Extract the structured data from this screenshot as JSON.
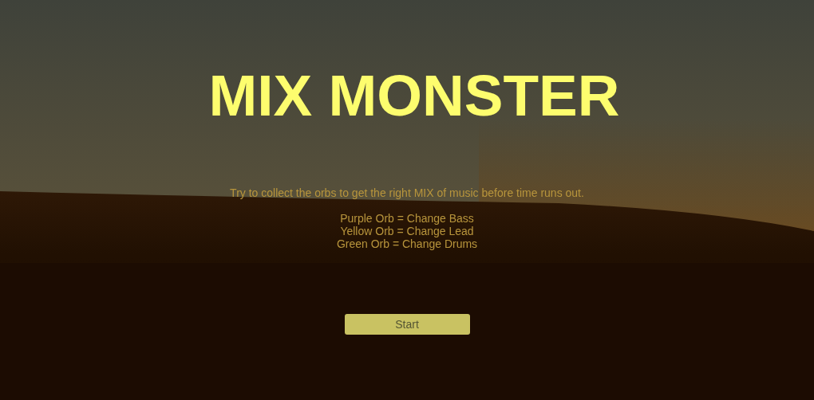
{
  "title": "MIX MONSTER",
  "intro": "Try to collect the orbs to get the right MIX of music before time runs out.",
  "legend": [
    "Purple Orb = Change Bass",
    "Yellow Orb = Change Lead",
    "Green Orb = Change Drums"
  ],
  "start_button": {
    "label": "Start"
  }
}
